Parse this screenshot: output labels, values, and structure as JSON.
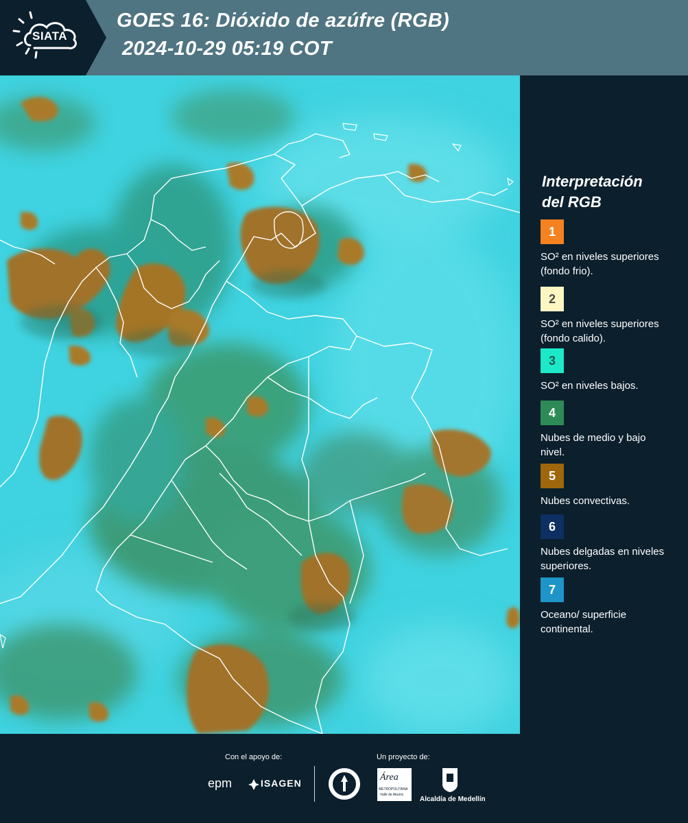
{
  "header": {
    "logo_text": "SIATA",
    "title_line1": "GOES 16: Dióxido de azúfre (RGB)",
    "title_line2": "2024-10-29 05:19 COT"
  },
  "legend": {
    "title_line1": "Interpretación",
    "title_line2": "del RGB",
    "items": [
      {
        "number": "1",
        "label": "SO² en niveles superiores (fondo frio).",
        "color": "#f58220",
        "text_color": "#ffffff"
      },
      {
        "number": "2",
        "label": "SO² en niveles superiores (fondo calido).",
        "color": "#fdf6c3",
        "text_color": "#4a4a4a"
      },
      {
        "number": "3",
        "label": "SO² en niveles bajos.",
        "color": "#1de9c8",
        "text_color": "#1a5a55"
      },
      {
        "number": "4",
        "label": "Nubes de medio y bajo nivel.",
        "color": "#2e8b57",
        "text_color": "#ffffff"
      },
      {
        "number": "5",
        "label": "Nubes convectivas.",
        "color": "#a0660c",
        "text_color": "#ffffff"
      },
      {
        "number": "6",
        "label": "Nubes delgadas en niveles superiores.",
        "color": "#0d2f62",
        "text_color": "#ffffff"
      },
      {
        "number": "7",
        "label": "Oceano/ superficie continental.",
        "color": "#1e95c8",
        "text_color": "#ffffff"
      }
    ]
  },
  "footer": {
    "support_label": "Con el apoyo de:",
    "project_label": "Un proyecto de:",
    "sponsor1": "epm",
    "sponsor2": "ISAGEN",
    "partner1": "METROPOLITANA",
    "partner1_sub": "Valle de Aburrá",
    "partner2": "Alcaldía de Medellín",
    "partner1_logo_text": "Área"
  },
  "colors": {
    "header_bg": "#4f7482",
    "page_bg": "#0b1f2d",
    "ocean_cyan": "#3fd2e0",
    "convective_brown": "#a0722a",
    "mid_cloud_green": "#3a8a5a"
  }
}
